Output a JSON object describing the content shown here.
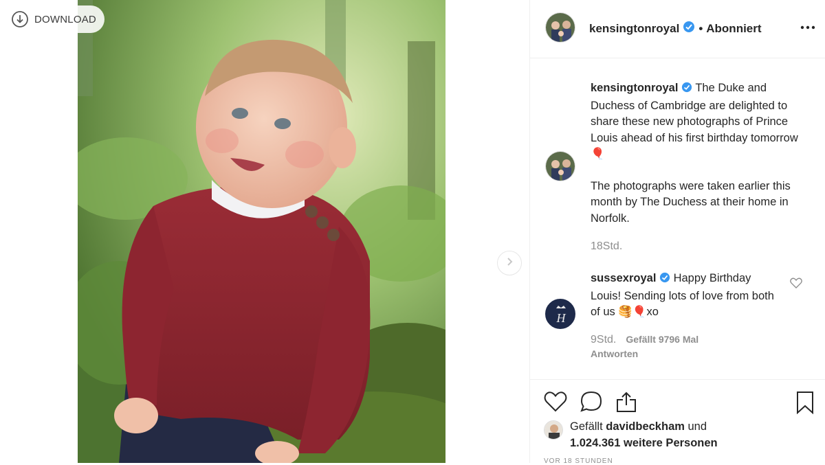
{
  "download": {
    "label": "DOWNLOAD",
    "icon": "download-icon"
  },
  "post": {
    "author": "kensingtonroyal",
    "follow_state": "Abonniert",
    "separator": "•"
  },
  "caption": {
    "username": "kensingtonroyal",
    "text1": "The Duke and Duchess of Cambridge are delighted to share these new photographs of Prince Louis ahead of his first birthday tomorrow 🎈",
    "text2": "The photographs were taken earlier this month by The Duchess at their home in Norfolk.",
    "time": "18Std."
  },
  "comment": {
    "username": "sussexroyal",
    "text": "Happy Birthday Louis! Sending lots of love from both of us 🥞🎈xo",
    "time": "9Std.",
    "likes": "Gefällt 9796 Mal",
    "reply": "Antworten"
  },
  "likes": {
    "prefix": "Gefällt ",
    "user": "davidbeckham",
    "middle": " und",
    "count": "1.024.361 weitere Personen"
  },
  "timestamp_cut": "VOR 18 STUNDEN",
  "colors": {
    "verified": "#3897f0",
    "text": "#262626",
    "muted": "#8e8e8e",
    "border": "#efefef"
  }
}
